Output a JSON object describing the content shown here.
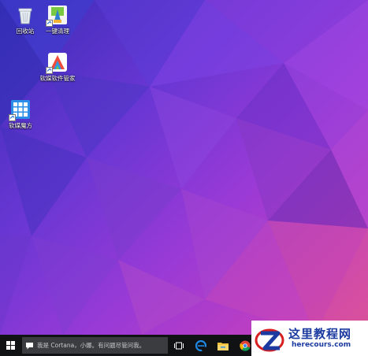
{
  "desktop": {
    "icons": [
      {
        "label": "回收站",
        "icon": "recycle-bin-icon"
      },
      {
        "label": "一键清理",
        "icon": "broom-cleaner-icon"
      },
      {
        "label": "软媒软件管家",
        "icon": "software-manager-icon"
      },
      {
        "label": "软媒魔方",
        "icon": "rubik-cube-icon"
      }
    ]
  },
  "taskbar": {
    "start_icon": "windows-logo-icon",
    "search_placeholder": "我是 Cortana，小娜。有问题尽管问我。",
    "task_view_icon": "task-view-icon",
    "pinned": [
      {
        "icon": "edge-browser-icon"
      },
      {
        "icon": "file-explorer-icon"
      },
      {
        "icon": "chrome-icon"
      }
    ]
  },
  "watermark": {
    "title": "这里教程网",
    "url": "herecours.com"
  },
  "colors": {
    "taskbar": "#101214",
    "search_box": "#3a3c40",
    "watermark_text": "#1b3aa0",
    "watermark_logo_red": "#d81e1e"
  }
}
